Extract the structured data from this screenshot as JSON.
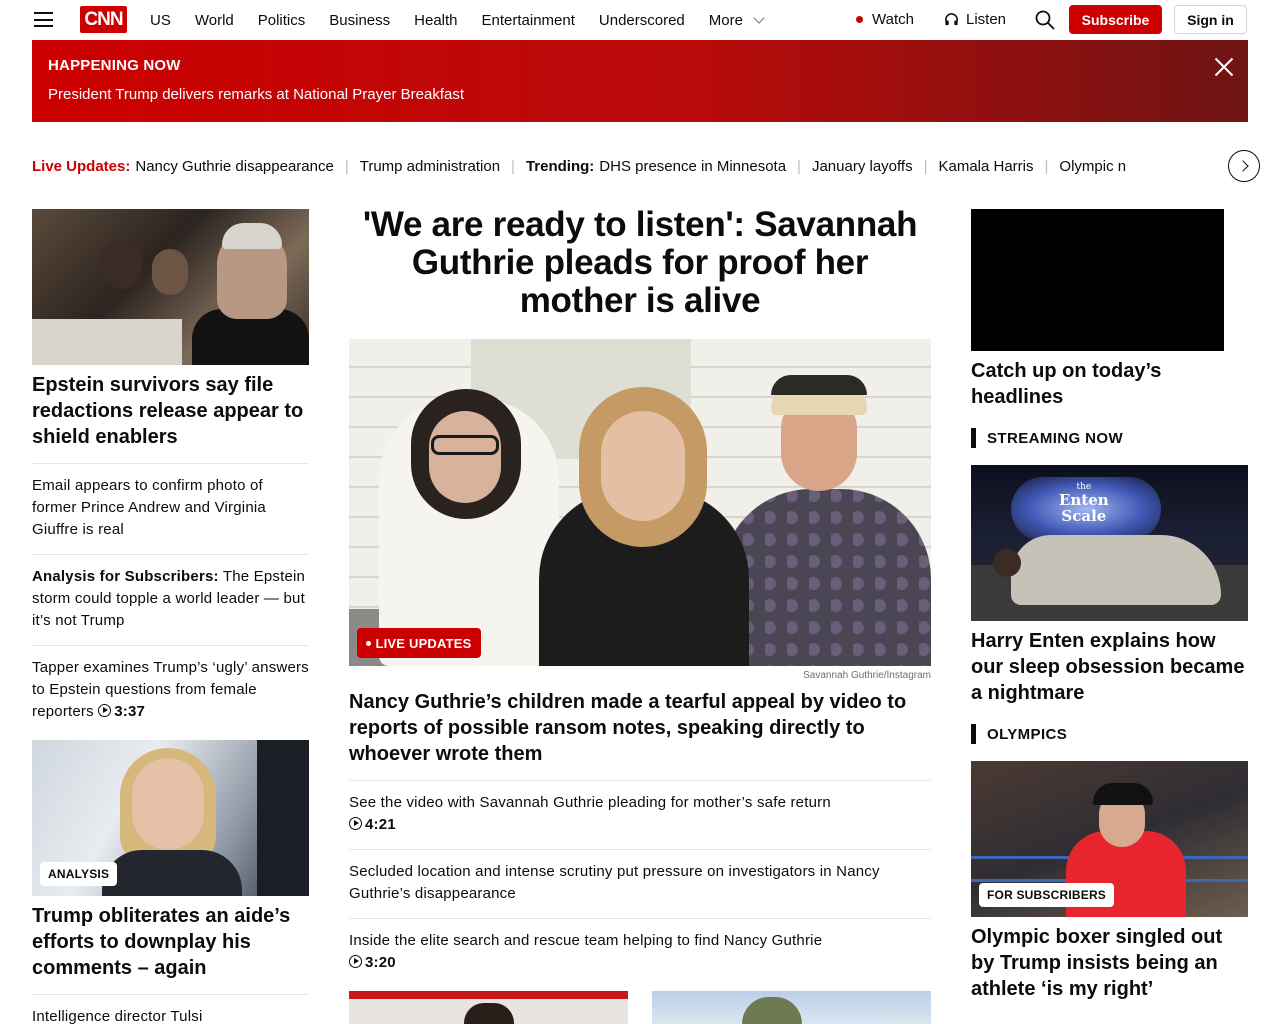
{
  "header": {
    "logo": "CNN",
    "nav": [
      "US",
      "World",
      "Politics",
      "Business",
      "Health",
      "Entertainment",
      "Underscored",
      "More"
    ],
    "watch": "Watch",
    "listen": "Listen",
    "subscribe": "Subscribe",
    "sign_in": "Sign in"
  },
  "banner": {
    "label": "HAPPENING NOW",
    "text": "President Trump delivers remarks at National Prayer Breakfast"
  },
  "trending": {
    "live_label": "Live Updates:",
    "live_item": "Nancy Guthrie disappearance",
    "item2": "Trump administration",
    "trending_label": "Trending:",
    "trending_item": "DHS presence in Minnesota",
    "item4": "January layoffs",
    "item5": "Kamala Harris",
    "item6": "Olympic n"
  },
  "left": {
    "lead_headline": "Epstein survivors say file redactions release appear to shield enablers",
    "items": [
      "Email appears to confirm photo of former Prince Andrew and Virginia Giuffre is real",
      "The Epstein storm could topple a world leader — but it’s not Trump",
      "Tapper examines Trump’s ‘ugly’ answers to Epstein questions from female reporters"
    ],
    "analysis_prefix": "Analysis for Subscribers:",
    "tapper_duration": "3:37",
    "aide_badge": "ANALYSIS",
    "aide_headline": "Trump obliterates an aide’s efforts to downplay his comments – again",
    "next_item": "Intelligence director Tulsi"
  },
  "center": {
    "title": "'We are ready to listen': Savannah Guthrie pleads for proof her mother is alive",
    "live_badge": "LIVE UPDATES",
    "credit": "Savannah Guthrie/Instagram",
    "sub_lead": "Nancy Guthrie’s children made a tearful appeal by video to reports of possible ransom notes, speaking directly to whoever wrote them",
    "items": [
      {
        "text": "See the video with Savannah Guthrie pleading for mother’s safe return",
        "duration": "4:21"
      },
      {
        "text": "Secluded location and intense scrutiny put pressure on investigators in Nancy Guthrie’s disappearance",
        "duration": ""
      },
      {
        "text": "Inside the elite search and rescue team helping to find Nancy Guthrie",
        "duration": "3:20"
      }
    ]
  },
  "right": {
    "video_headline": "Catch up on today’s headlines",
    "streaming_label": "STREAMING NOW",
    "stream_logo_line1": "the",
    "stream_logo_line2": "Enten",
    "stream_logo_line3": "Scale",
    "stream_headline": "Harry Enten explains how our sleep obsession became a nightmare",
    "olympics_label": "OLYMPICS",
    "boxer_badge": "FOR SUBSCRIBERS",
    "boxer_headline": "Olympic boxer singled out by Trump insists being an athlete ‘is my right’"
  },
  "colors": {
    "brand_red": "#cc0000",
    "text": "#0c0c0c"
  }
}
